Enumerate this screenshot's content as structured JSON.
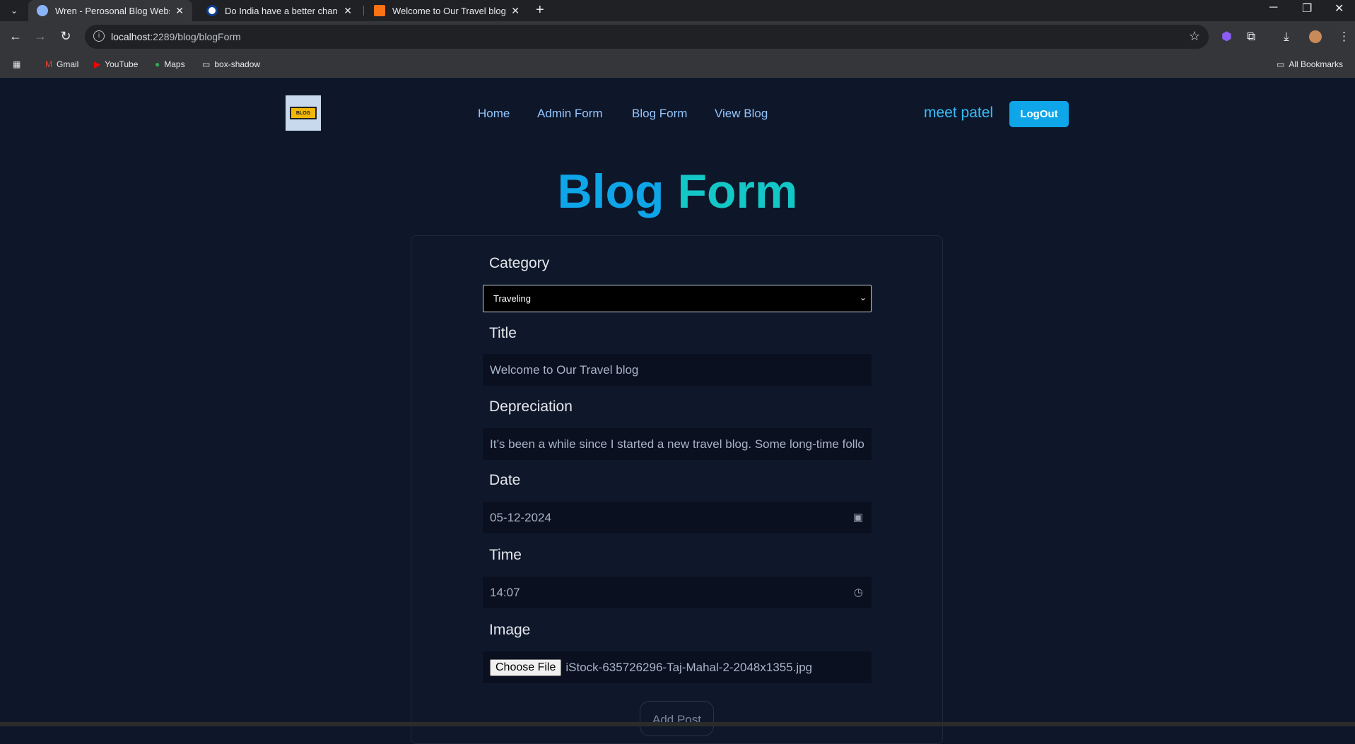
{
  "browser": {
    "tabs": [
      {
        "title": "Wren - Perosonal Blog Website",
        "active": true
      },
      {
        "title": "Do India have a better chance t",
        "active": false
      },
      {
        "title": "Welcome to Our Travel blog – I",
        "active": false
      }
    ],
    "url_host": "localhost",
    "url_path": ":2289/blog/blogForm",
    "bookmarks": [
      "Gmail",
      "YouTube",
      "Maps",
      "box-shadow"
    ],
    "all_bookmarks": "All Bookmarks"
  },
  "site": {
    "logo_text": "BLOG",
    "nav": [
      "Home",
      "Admin Form",
      "Blog Form",
      "View Blog"
    ],
    "user_name": "meet patel",
    "logout_label": "LogOut"
  },
  "form": {
    "title_word1": "Blog",
    "title_word2": "Form",
    "category_label": "Category",
    "category_value": "Traveling",
    "title_label": "Title",
    "title_value": "Welcome to Our Travel blog",
    "description_label": "Depreciation",
    "description_value": "It’s been a while since I started a new travel blog. Some long-time follo",
    "date_label": "Date",
    "date_value": "05-12-2024",
    "time_label": "Time",
    "time_value": "14:07",
    "image_label": "Image",
    "choose_file_label": "Choose File",
    "image_filename": "iStock-635726296-Taj-Mahal-2-2048x1355.jpg",
    "submit_label": "Add Post"
  }
}
